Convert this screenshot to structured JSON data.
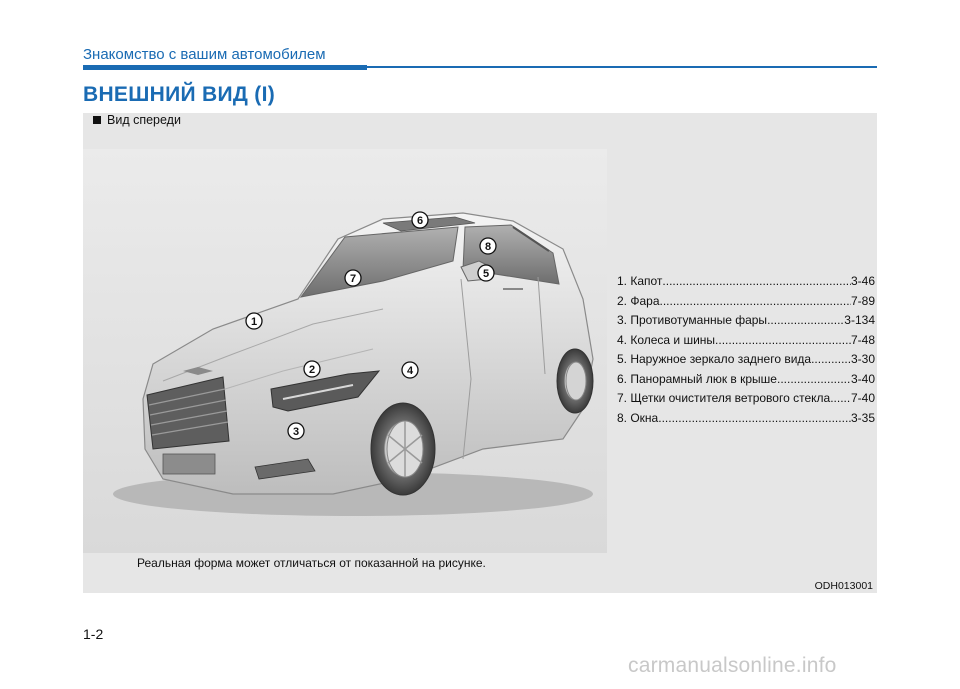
{
  "header": {
    "section": "Знакомство с вашим автомобилем"
  },
  "title": "ВНЕШНИЙ ВИД (I)",
  "figure": {
    "caption": "Вид спереди",
    "note": "Реальная форма может отличаться от показанной на рисунке.",
    "code": "ODH013001",
    "callouts": [
      "1",
      "2",
      "3",
      "4",
      "5",
      "6",
      "7",
      "8"
    ]
  },
  "legend": [
    {
      "label": "1. Капот",
      "page": "3-46"
    },
    {
      "label": "2. Фара",
      "page": "7-89"
    },
    {
      "label": "3. Противотуманные фары",
      "page": "3-134"
    },
    {
      "label": "4. Колеса и шины",
      "page": "7-48"
    },
    {
      "label": "5. Наружное зеркало заднего вида",
      "page": "3-30"
    },
    {
      "label": "6. Панорамный люк в крыше",
      "page": "3-40"
    },
    {
      "label": "7. Щетки очистителя ветрового стекла",
      "page": "7-40"
    },
    {
      "label": "8. Окна",
      "page": "3-35"
    }
  ],
  "page_number": "1-2",
  "watermark": "carmanualsonline.info"
}
